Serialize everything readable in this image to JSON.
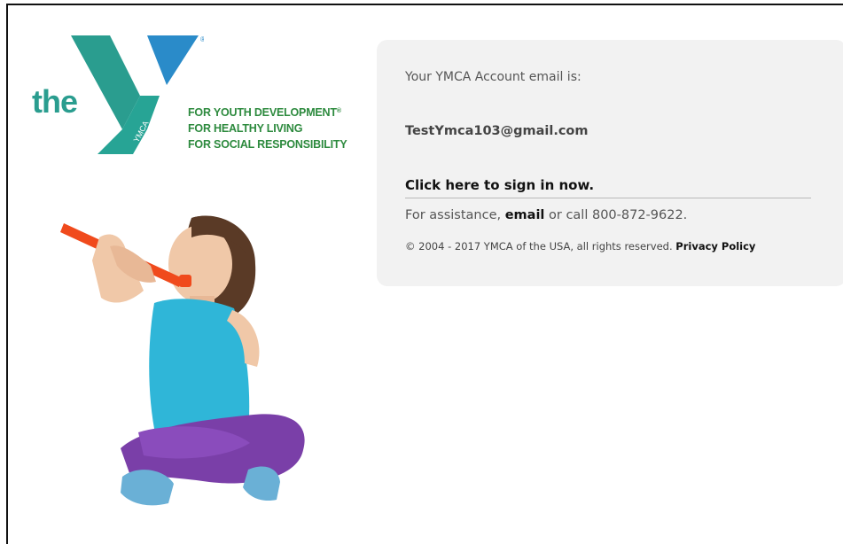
{
  "logo": {
    "prefix": "the",
    "mark_text": "YMCA",
    "registered": "®",
    "tagline": [
      "FOR YOUTH DEVELOPMENT",
      "FOR HEALTHY LIVING",
      "FOR SOCIAL RESPONSIBILITY"
    ],
    "colors": {
      "teal": "#2a9d8f",
      "blue": "#2a8bc9",
      "green": "#2d8a3e"
    }
  },
  "panel": {
    "email_label": "Your YMCA Account email is:",
    "email": "TestYmca103@gmail.com",
    "signin_link": "Click here to sign in now.",
    "assist_prefix": "For assistance, ",
    "assist_link": "email",
    "assist_suffix": " or call 800-872-9622.",
    "copyright": "© 2004 - 2017 YMCA of the USA, all rights reserved. ",
    "privacy_link": "Privacy Policy"
  }
}
